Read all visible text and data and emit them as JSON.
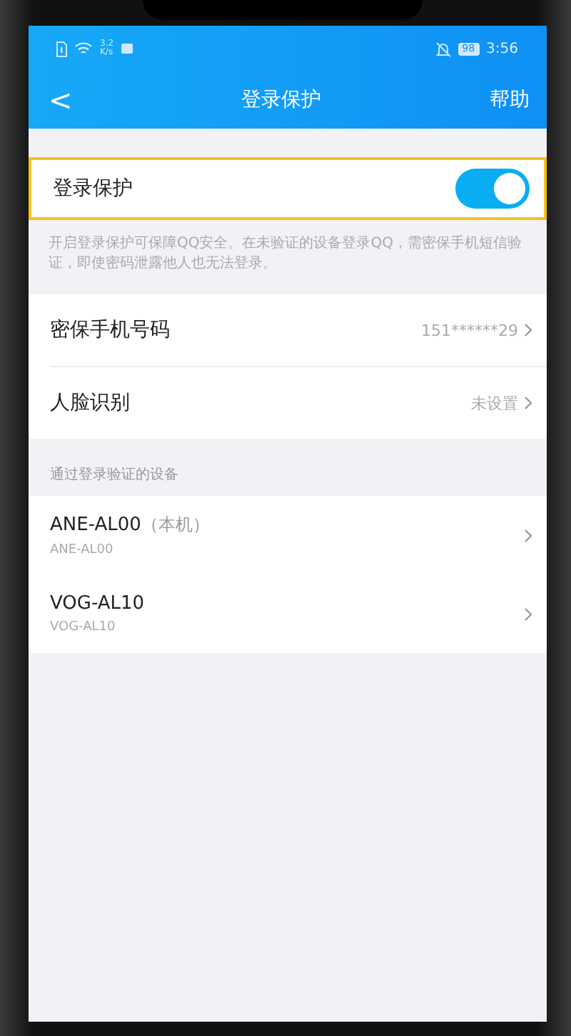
{
  "status_bar": {
    "speed": "3.2",
    "speed_unit": "K/s",
    "battery": "98",
    "time": "3:56"
  },
  "nav": {
    "back": "<",
    "title": "登录保护",
    "action": "帮助"
  },
  "protection": {
    "label": "登录保护",
    "on": true,
    "highlighted": true,
    "description": "开启登录保护可保障QQ安全。在未验证的设备登录QQ，需密保手机短信验证，即使密码泄露他人也无法登录。"
  },
  "settings": [
    {
      "label": "密保手机号码",
      "value": "151******29"
    },
    {
      "label": "人脸识别",
      "value": "未设置"
    }
  ],
  "devices_header": "通过登录验证的设备",
  "devices": [
    {
      "name": "ANE-AL00",
      "note": "（本机）",
      "model": "ANE-AL00"
    },
    {
      "name": "VOG-AL10",
      "model": "VOG-AL10"
    }
  ]
}
